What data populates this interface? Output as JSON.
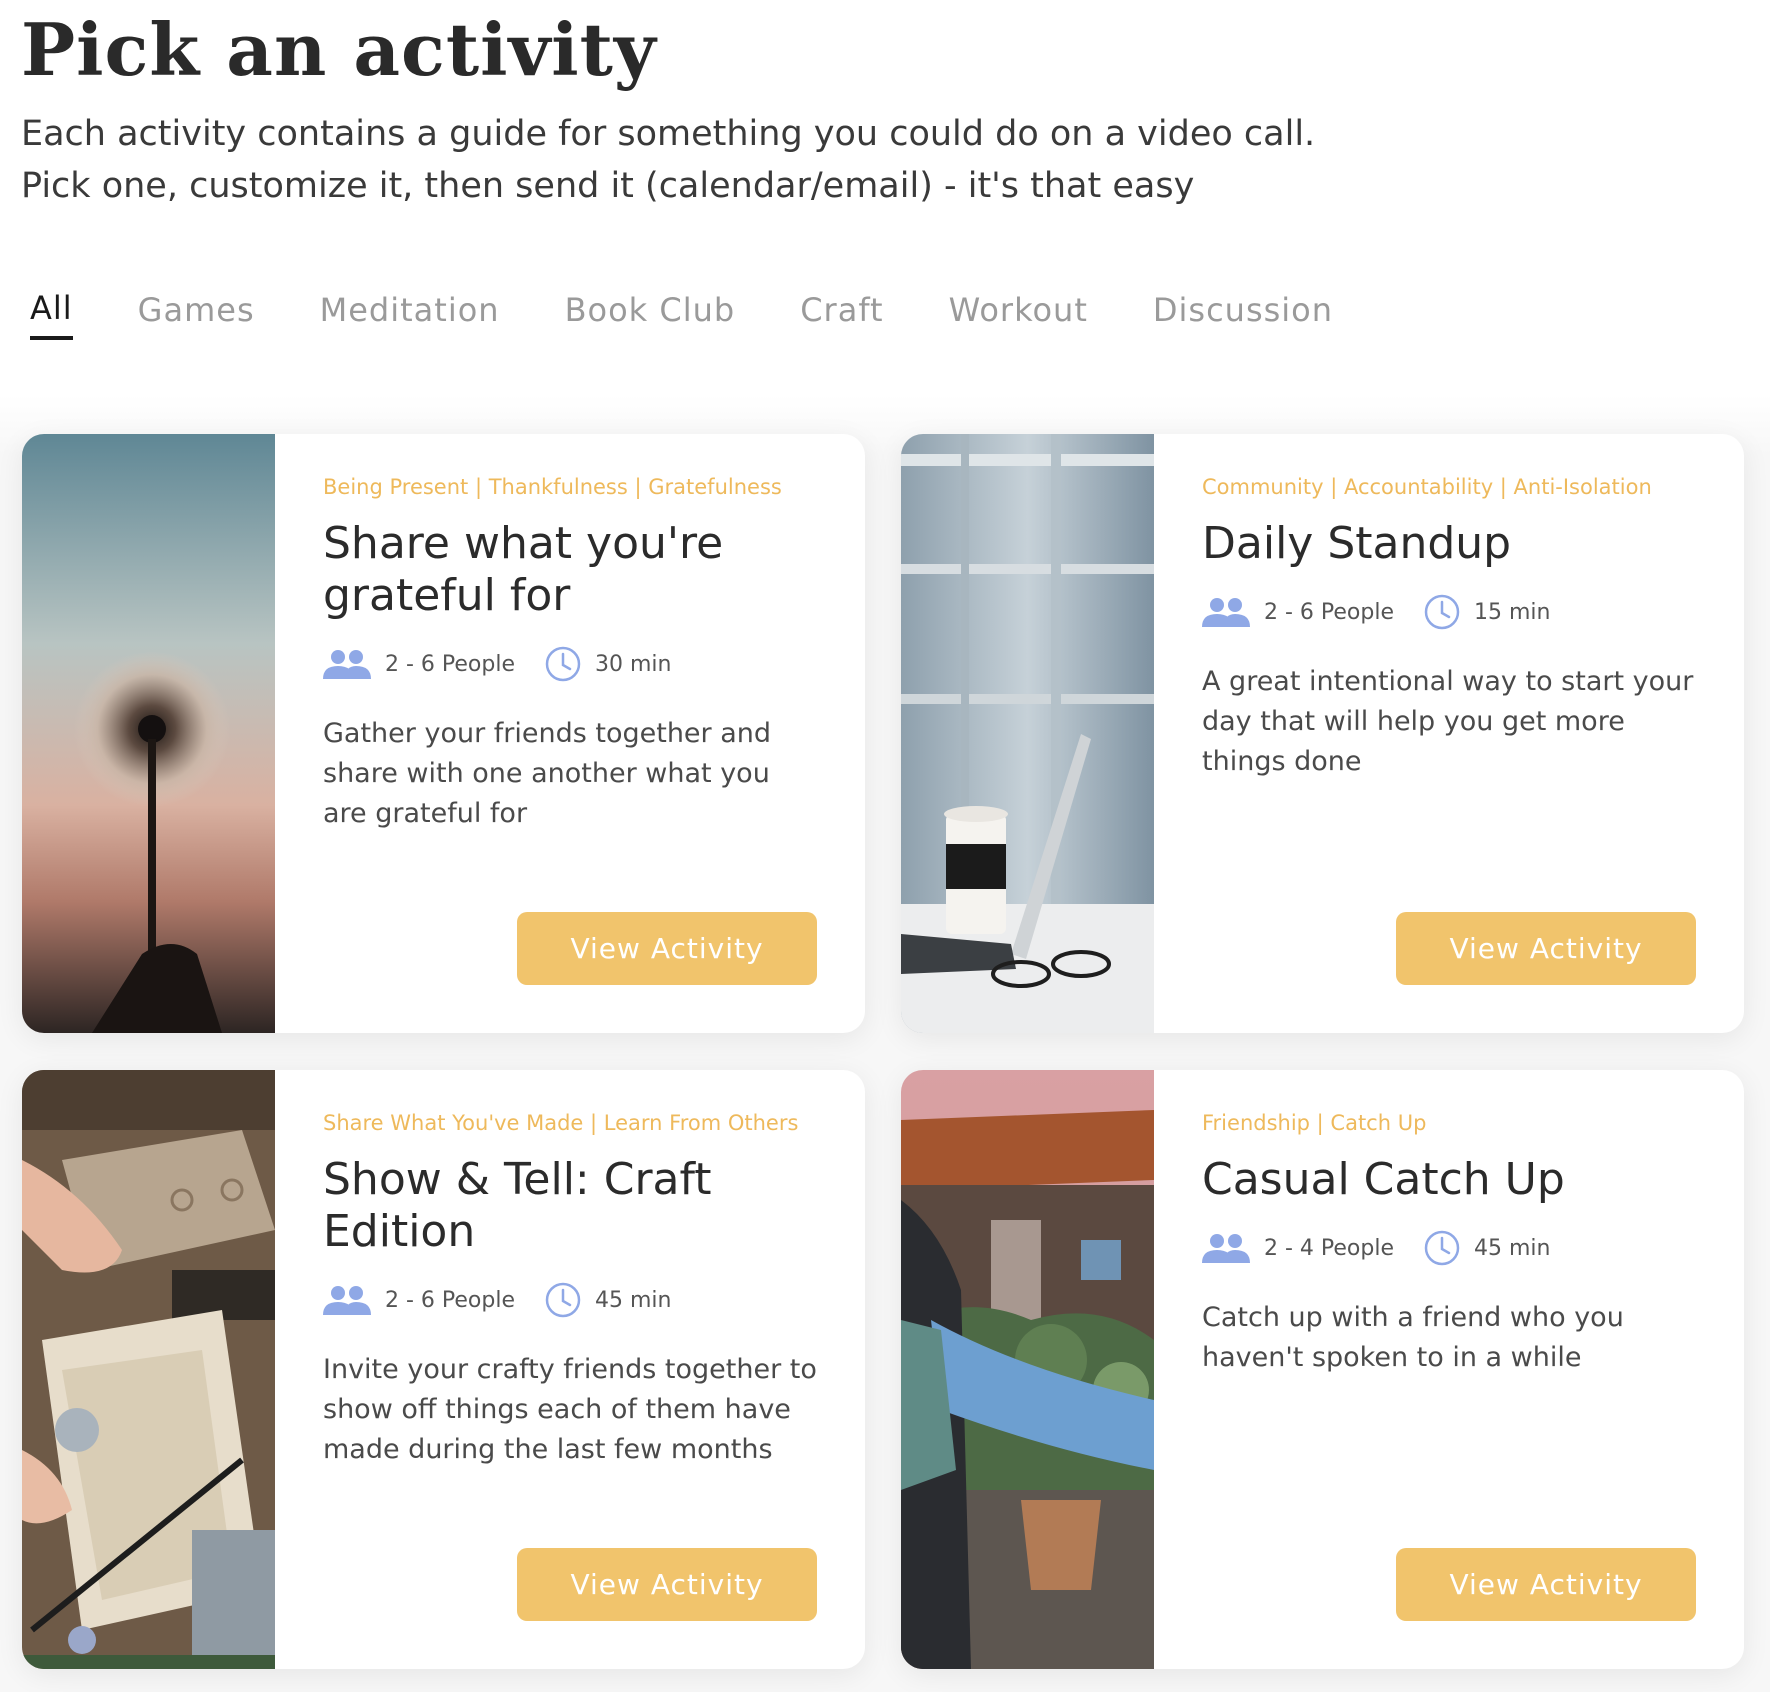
{
  "page": {
    "title": "Pick an activity",
    "intro_line1": "Each activity contains a guide for something you could do on a video call.",
    "intro_line2": "Pick one, customize it, then send it (calendar/email) - it's that easy"
  },
  "tabs": [
    {
      "label": "All",
      "active": true
    },
    {
      "label": "Games",
      "active": false
    },
    {
      "label": "Meditation",
      "active": false
    },
    {
      "label": "Book Club",
      "active": false
    },
    {
      "label": "Craft",
      "active": false
    },
    {
      "label": "Workout",
      "active": false
    },
    {
      "label": "Discussion",
      "active": false
    }
  ],
  "colors": {
    "accent": "#f1c46c",
    "tag_text": "#eeb95b",
    "icon_blue": "#8fa8e6"
  },
  "cards": [
    {
      "tags": "Being Present | Thankfulness | Gratefulness",
      "title": "Share what you're grateful for",
      "people": "2 - 6 People",
      "time": "30 min",
      "description": "Gather your friends together and share with one another what you are grateful for",
      "button": "View Activity",
      "image": "dandelion-photo"
    },
    {
      "tags": "Community | Accountability | Anti-Isolation",
      "title": "Daily Standup",
      "people": "2 - 6 People",
      "time": "15 min",
      "description": "A great intentional way to start your day that will help you get more things done",
      "button": "View Activity",
      "image": "laptop-coffee-photo"
    },
    {
      "tags": "Share What You've Made | Learn From Others",
      "title": "Show & Tell: Craft Edition",
      "people": "2 - 6 People",
      "time": "45 min",
      "description": "Invite your crafty friends together to show off things each of them have made during the last few months",
      "button": "View Activity",
      "image": "craft-desk-photo"
    },
    {
      "tags": "Friendship | Catch Up",
      "title": "Casual Catch Up",
      "people": "2 - 4 People",
      "time": "45 min",
      "description": "Catch up with a friend who you haven't spoken to in a while",
      "button": "View Activity",
      "image": "friends-outdoors-photo"
    }
  ]
}
